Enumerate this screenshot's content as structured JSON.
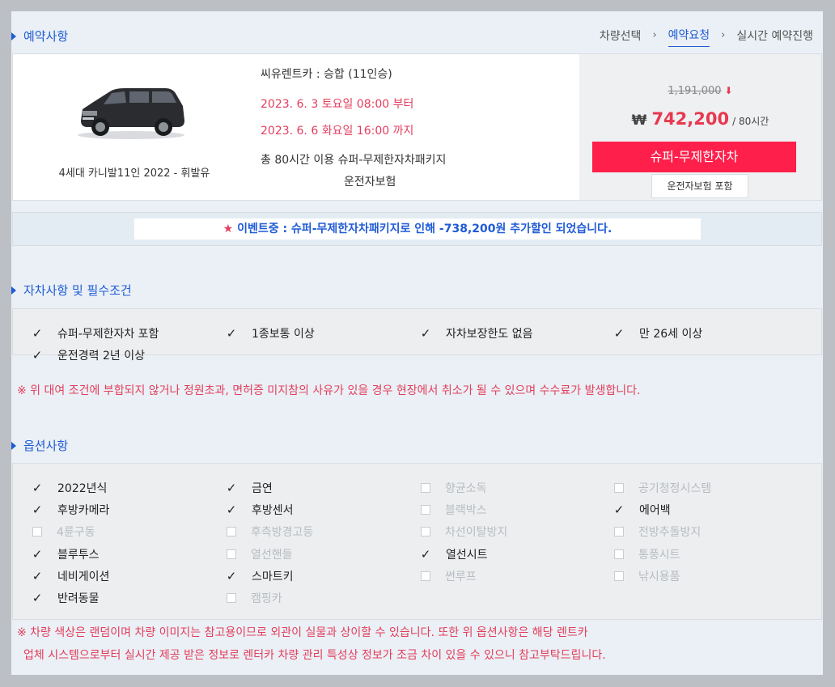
{
  "reservation": {
    "title": "예약사항",
    "steps": [
      {
        "label": "차량선택",
        "active": false
      },
      {
        "label": "예약요청",
        "active": true
      },
      {
        "label": "실시간 예약진행",
        "active": false
      }
    ],
    "step_separator": "›",
    "car_name": "4세대 카니발11인 2022 - 휘발유",
    "company_line": "씨유렌트카 : 승합 (11인승)",
    "start": "2023. 6. 3 토요일 08:00 부터",
    "end": "2023. 6. 6 화요일 16:00 까지",
    "usage": "총 80시간 이용 슈퍼-무제한자차패키지",
    "insurance": "운전자보험",
    "original_price": "1,191,000",
    "price_currency": "₩",
    "price": "742,200",
    "price_unit": "/ 80시간",
    "super_button": "슈퍼-무제한자차",
    "insurance_button": "운전자보험 포함"
  },
  "event": {
    "star": "★",
    "text": "이벤트중 : 슈퍼-무제한자차패키지로 인해 -738,200원 추가할인 되었습니다."
  },
  "conditions": {
    "title": "자차사항 및 필수조건",
    "items": [
      "슈퍼-무제한자차 포함",
      "1종보통 이상",
      "자차보장한도 없음",
      "만 26세 이상",
      "운전경력 2년 이상"
    ],
    "warning": "※ 위 대여 조건에 부합되지 않거나 정원초과, 면허증 미지참의 사유가 있을 경우 현장에서 취소가 될 수 있으며 수수료가 발생합니다."
  },
  "options": {
    "title": "옵션사항",
    "items": [
      {
        "label": "2022년식",
        "checked": true
      },
      {
        "label": "금연",
        "checked": true
      },
      {
        "label": "향균소독",
        "checked": false
      },
      {
        "label": "공기청정시스템",
        "checked": false
      },
      {
        "label": "후방카메라",
        "checked": true
      },
      {
        "label": "후방센서",
        "checked": true
      },
      {
        "label": "블랙박스",
        "checked": false
      },
      {
        "label": "에어백",
        "checked": true
      },
      {
        "label": "4륜구동",
        "checked": false
      },
      {
        "label": "후측방경고등",
        "checked": false
      },
      {
        "label": "차선이탈방지",
        "checked": false
      },
      {
        "label": "전방추돌방지",
        "checked": false
      },
      {
        "label": "블루투스",
        "checked": true
      },
      {
        "label": "열선핸들",
        "checked": false
      },
      {
        "label": "열선시트",
        "checked": true
      },
      {
        "label": "통풍시트",
        "checked": false
      },
      {
        "label": "네비게이션",
        "checked": true
      },
      {
        "label": "스마트키",
        "checked": true
      },
      {
        "label": "썬루프",
        "checked": false
      },
      {
        "label": "낚시용품",
        "checked": false
      },
      {
        "label": "반려동물",
        "checked": true
      },
      {
        "label": "캠핑카",
        "checked": false
      }
    ],
    "warning_line1": "※ 차량 색상은 랜덤이며 차량 이미지는 참고용이므로 외관이 실물과 상이할 수 있습니다. 또한 위 옵션사항은 해당 렌트카",
    "warning_line2": "업체 시스템으로부터 실시간 제공 받은 정보로 렌터카 차량 관리 특성상 정보가 조금 차이 있을 수 있으니 참고부탁드립니다."
  },
  "colors": {
    "accent_blue": "#1f5bd6",
    "accent_red": "#e43d5c",
    "button_red": "#fe1f4b"
  }
}
